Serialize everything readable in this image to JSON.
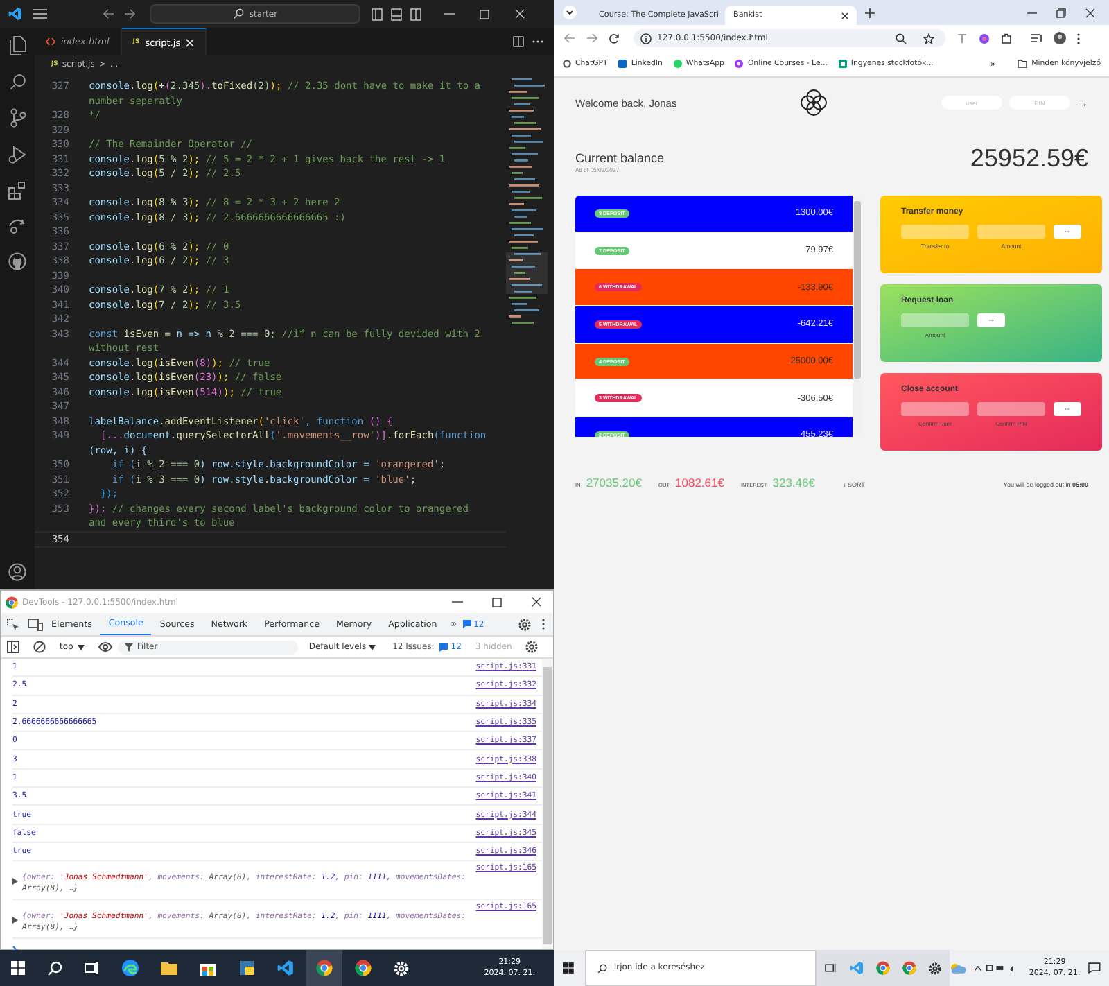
{
  "vscode": {
    "search": "starter",
    "tabs": [
      {
        "label": "index.html",
        "kind": "html",
        "selected": false
      },
      {
        "label": "script.js",
        "kind": "js",
        "icon_text": "JS",
        "selected": true
      }
    ],
    "breadcrumb": {
      "icon_text": "JS",
      "file": "script.js",
      "separator": ">",
      "rest": "..."
    },
    "lines": [
      {
        "n": "327",
        "tokens": [
          {
            "text": "console",
            "kind": "var"
          },
          {
            "text": ".",
            "kind": "plain"
          },
          {
            "text": "log",
            "kind": "fn"
          },
          {
            "text": "(",
            "kind": "gold"
          },
          {
            "text": "+",
            "kind": "plain"
          },
          {
            "text": "(",
            "kind": "pink"
          },
          {
            "text": "2.345",
            "kind": "num"
          },
          {
            "text": ").",
            "kind": "pink"
          },
          {
            "text": "toFixed",
            "kind": "fn"
          },
          {
            "text": "(2)",
            "kind": "num"
          },
          {
            "text": ");",
            "kind": "gold"
          },
          {
            "text": " // 2.35 dont have to make it to a number seperatly",
            "kind": "comment"
          }
        ]
      },
      {
        "n": "328",
        "tokens": [
          {
            "text": "*/",
            "kind": "comment"
          }
        ]
      },
      {
        "n": "329"
      },
      {
        "n": "330",
        "tokens": [
          {
            "text": "// The Remainder Operator //",
            "kind": "comment"
          }
        ]
      },
      {
        "n": "331",
        "tokens": [
          {
            "text": "console",
            "kind": "var"
          },
          {
            "text": ".",
            "kind": "plain"
          },
          {
            "text": "log",
            "kind": "fn"
          },
          {
            "text": "(",
            "kind": "gold"
          },
          {
            "text": "5 % 2",
            "kind": "num"
          },
          {
            "text": ");",
            "kind": "gold"
          },
          {
            "text": " // 5 = 2 * 2 + 1 gives back the rest -> 1",
            "kind": "comment"
          }
        ]
      },
      {
        "n": "332",
        "tokens": [
          {
            "text": "console",
            "kind": "var"
          },
          {
            "text": ".",
            "kind": "plain"
          },
          {
            "text": "log",
            "kind": "fn"
          },
          {
            "text": "(",
            "kind": "gold"
          },
          {
            "text": "5 / 2",
            "kind": "num"
          },
          {
            "text": ");",
            "kind": "gold"
          },
          {
            "text": " // 2.5",
            "kind": "comment"
          }
        ]
      },
      {
        "n": "333"
      },
      {
        "n": "334",
        "tokens": [
          {
            "text": "console",
            "kind": "var"
          },
          {
            "text": ".",
            "kind": "plain"
          },
          {
            "text": "log",
            "kind": "fn"
          },
          {
            "text": "(",
            "kind": "gold"
          },
          {
            "text": "8 % 3",
            "kind": "num"
          },
          {
            "text": ");",
            "kind": "gold"
          },
          {
            "text": " // 8 = 2 * 3 + 2 here 2",
            "kind": "comment"
          }
        ]
      },
      {
        "n": "335",
        "tokens": [
          {
            "text": "console",
            "kind": "var"
          },
          {
            "text": ".",
            "kind": "plain"
          },
          {
            "text": "log",
            "kind": "fn"
          },
          {
            "text": "(",
            "kind": "gold"
          },
          {
            "text": "8 / 3",
            "kind": "num"
          },
          {
            "text": ");",
            "kind": "gold"
          },
          {
            "text": " // 2.6666666666666665 :)",
            "kind": "comment"
          }
        ]
      },
      {
        "n": "336"
      },
      {
        "n": "337",
        "tokens": [
          {
            "text": "console",
            "kind": "var"
          },
          {
            "text": ".",
            "kind": "plain"
          },
          {
            "text": "log",
            "kind": "fn"
          },
          {
            "text": "(",
            "kind": "gold"
          },
          {
            "text": "6 % 2",
            "kind": "num"
          },
          {
            "text": ");",
            "kind": "gold"
          },
          {
            "text": " // 0",
            "kind": "comment"
          }
        ]
      },
      {
        "n": "338",
        "tokens": [
          {
            "text": "console",
            "kind": "var"
          },
          {
            "text": ".",
            "kind": "plain"
          },
          {
            "text": "log",
            "kind": "fn"
          },
          {
            "text": "(",
            "kind": "gold"
          },
          {
            "text": "6 / 2",
            "kind": "num"
          },
          {
            "text": ");",
            "kind": "gold"
          },
          {
            "text": " // 3",
            "kind": "comment"
          }
        ]
      },
      {
        "n": "339"
      },
      {
        "n": "340",
        "tokens": [
          {
            "text": "console",
            "kind": "var"
          },
          {
            "text": ".",
            "kind": "plain"
          },
          {
            "text": "log",
            "kind": "fn"
          },
          {
            "text": "(",
            "kind": "gold"
          },
          {
            "text": "7 % 2",
            "kind": "num"
          },
          {
            "text": ");",
            "kind": "gold"
          },
          {
            "text": " // 1",
            "kind": "comment"
          }
        ]
      },
      {
        "n": "341",
        "tokens": [
          {
            "text": "console",
            "kind": "var"
          },
          {
            "text": ".",
            "kind": "plain"
          },
          {
            "text": "log",
            "kind": "fn"
          },
          {
            "text": "(",
            "kind": "gold"
          },
          {
            "text": "7 / 2",
            "kind": "num"
          },
          {
            "text": ");",
            "kind": "gold"
          },
          {
            "text": " // 3.5",
            "kind": "comment"
          }
        ]
      },
      {
        "n": "342"
      },
      {
        "n": "343",
        "tokens": [
          {
            "text": "const ",
            "kind": "keyword"
          },
          {
            "text": "isEven = ",
            "kind": "fn"
          },
          {
            "text": "n => n",
            "kind": "var"
          },
          {
            "text": " % 2 === 0;",
            "kind": "num"
          },
          {
            "text": " //if n can be fully devided with 2 without rest",
            "kind": "comment"
          }
        ]
      },
      {
        "n": "344",
        "tokens": [
          {
            "text": "console",
            "kind": "var"
          },
          {
            "text": ".",
            "kind": "plain"
          },
          {
            "text": "log",
            "kind": "fn"
          },
          {
            "text": "(",
            "kind": "gold"
          },
          {
            "text": "isEven",
            "kind": "fn"
          },
          {
            "text": "(8)",
            "kind": "pink"
          },
          {
            "text": ");",
            "kind": "gold"
          },
          {
            "text": " // true",
            "kind": "comment"
          }
        ]
      },
      {
        "n": "345",
        "tokens": [
          {
            "text": "console",
            "kind": "var"
          },
          {
            "text": ".",
            "kind": "plain"
          },
          {
            "text": "log",
            "kind": "fn"
          },
          {
            "text": "(",
            "kind": "gold"
          },
          {
            "text": "isEven",
            "kind": "fn"
          },
          {
            "text": "(23)",
            "kind": "pink"
          },
          {
            "text": ");",
            "kind": "gold"
          },
          {
            "text": " // false",
            "kind": "comment"
          }
        ]
      },
      {
        "n": "346",
        "tokens": [
          {
            "text": "console",
            "kind": "var"
          },
          {
            "text": ".",
            "kind": "plain"
          },
          {
            "text": "log",
            "kind": "fn"
          },
          {
            "text": "(",
            "kind": "gold"
          },
          {
            "text": "isEven",
            "kind": "fn"
          },
          {
            "text": "(514)",
            "kind": "pink"
          },
          {
            "text": ");",
            "kind": "gold"
          },
          {
            "text": " // true",
            "kind": "comment"
          }
        ]
      },
      {
        "n": "347"
      },
      {
        "n": "348",
        "tokens": [
          {
            "text": "labelBalance.",
            "kind": "var"
          },
          {
            "text": "addEventListener",
            "kind": "fn"
          },
          {
            "text": "(",
            "kind": "gold"
          },
          {
            "text": "'click'",
            "kind": "string"
          },
          {
            "text": ", function",
            "kind": "keyword"
          },
          {
            "text": " () {",
            "kind": "pink"
          }
        ]
      },
      {
        "n": "349",
        "tokens": [
          {
            "text": "  [...",
            "kind": "pink"
          },
          {
            "text": "document.",
            "kind": "var"
          },
          {
            "text": "querySelectorAll",
            "kind": "fn"
          },
          {
            "text": "(",
            "kind": "blue"
          },
          {
            "text": "'.movements__row'",
            "kind": "string"
          },
          {
            "text": ")]",
            "kind": "pink"
          },
          {
            "text": ".forEach",
            "kind": "fn"
          },
          {
            "text": "(function",
            "kind": "keyword"
          },
          {
            "text": " (row, i) {",
            "kind": "var"
          }
        ]
      },
      {
        "n": "350",
        "tokens": [
          {
            "text": "    if (",
            "kind": "keyword"
          },
          {
            "text": "i % 2 === 0",
            "kind": "num"
          },
          {
            "text": ") row.style.backgroundColor = ",
            "kind": "var"
          },
          {
            "text": "'orangered'",
            "kind": "string"
          },
          {
            "text": ";",
            "kind": "plain"
          }
        ]
      },
      {
        "n": "351",
        "tokens": [
          {
            "text": "    if (",
            "kind": "keyword"
          },
          {
            "text": "i % 3 === 0",
            "kind": "num"
          },
          {
            "text": ") row.style.backgroundColor = ",
            "kind": "var"
          },
          {
            "text": "'blue'",
            "kind": "string"
          },
          {
            "text": ";",
            "kind": "plain"
          }
        ]
      },
      {
        "n": "352",
        "tokens": [
          {
            "text": "  });",
            "kind": "blue"
          }
        ]
      },
      {
        "n": "353",
        "tokens": [
          {
            "text": "});",
            "kind": "pink"
          },
          {
            "text": " // changes every second label's background color to orangered and every third's to blue",
            "kind": "comment"
          }
        ]
      },
      {
        "n": "354",
        "current": true
      }
    ]
  },
  "devtools": {
    "title": "DevTools - 127.0.0.1:5500/index.html",
    "tabs": [
      {
        "label": "Elements",
        "selected": false
      },
      {
        "label": "Console",
        "selected": true
      },
      {
        "label": "Sources",
        "selected": false
      },
      {
        "label": "Network",
        "selected": false
      },
      {
        "label": "Performance",
        "selected": false
      },
      {
        "label": "Memory",
        "selected": false
      },
      {
        "label": "Application",
        "selected": false
      }
    ],
    "more": "»",
    "issues_badge": "12",
    "context": "top",
    "filter_placeholder": "Filter",
    "levels": "Default levels",
    "issues_label": "12 Issues:",
    "issues_count": "12",
    "hidden": "3 hidden",
    "messages": [
      {
        "kind": "value",
        "text": "1",
        "source": "script.js:331"
      },
      {
        "kind": "value",
        "text": "2.5",
        "source": "script.js:332"
      },
      {
        "kind": "value",
        "text": "2",
        "source": "script.js:334"
      },
      {
        "kind": "value",
        "text": "2.6666666666666665",
        "source": "script.js:335"
      },
      {
        "kind": "value",
        "text": "0",
        "source": "script.js:337"
      },
      {
        "kind": "value",
        "text": "3",
        "source": "script.js:338"
      },
      {
        "kind": "value",
        "text": "1",
        "source": "script.js:340"
      },
      {
        "kind": "value",
        "text": "3.5",
        "source": "script.js:341"
      },
      {
        "kind": "value",
        "text": "true",
        "source": "script.js:344"
      },
      {
        "kind": "value",
        "text": "false",
        "source": "script.js:345"
      },
      {
        "kind": "value",
        "text": "true",
        "source": "script.js:346"
      },
      {
        "kind": "object",
        "source": "script.js:165",
        "expanded": false,
        "tokens": [
          {
            "text": "{owner: ",
            "kind": "key"
          },
          {
            "text": "'Jonas Schmedtmann'",
            "kind": "string"
          },
          {
            "text": ", movements: ",
            "kind": "key"
          },
          {
            "text": "Array(8)",
            "kind": "value"
          },
          {
            "text": ", interestRate: ",
            "kind": "key"
          },
          {
            "text": "1.2",
            "kind": "num"
          },
          {
            "text": ", pin: ",
            "kind": "key"
          },
          {
            "text": "1111",
            "kind": "num"
          },
          {
            "text": ", movementsDates: ",
            "kind": "key"
          },
          {
            "text": "Array(8), …}",
            "kind": "value"
          }
        ]
      },
      {
        "kind": "object",
        "source": "script.js:165",
        "expanded": false,
        "tokens": [
          {
            "text": "{owner: ",
            "kind": "key"
          },
          {
            "text": "'Jonas Schmedtmann'",
            "kind": "string"
          },
          {
            "text": ", movements: ",
            "kind": "key"
          },
          {
            "text": "Array(8)",
            "kind": "value"
          },
          {
            "text": ", interestRate: ",
            "kind": "key"
          },
          {
            "text": "1.2",
            "kind": "num"
          },
          {
            "text": ", pin: ",
            "kind": "key"
          },
          {
            "text": "1111",
            "kind": "num"
          },
          {
            "text": ", movementsDates: ",
            "kind": "key"
          },
          {
            "text": "Array(8), …}",
            "kind": "value"
          }
        ]
      }
    ]
  },
  "browser": {
    "tabs": [
      {
        "title": "Course: The Complete JavaScri",
        "selected": false
      },
      {
        "title": "Bankist",
        "selected": true
      }
    ],
    "url": "127.0.0.1:5500/index.html",
    "bookmarks": [
      {
        "label": "ChatGPT",
        "kind": "gpt"
      },
      {
        "label": "LinkedIn",
        "kind": "in"
      },
      {
        "label": "WhatsApp",
        "kind": "wa"
      },
      {
        "label": "Online Courses - Le...",
        "kind": "course"
      },
      {
        "label": "Ingyenes stockfotók...",
        "kind": "photo"
      }
    ],
    "more": "»",
    "all_bookmarks": "Minden könyvjelző"
  },
  "bank": {
    "welcome": "Welcome back, Jonas",
    "user_placeholder": "user",
    "pin_placeholder": "PIN",
    "login": "→",
    "balance_label": "Current balance",
    "date": "As of 05/03/2037",
    "balance": "25952.59€",
    "movements": [
      {
        "type": "8 DEPOSIT",
        "kind": "deposit",
        "value": "1300.00€",
        "color": "#0000ff"
      },
      {
        "type": "7 DEPOSIT",
        "kind": "deposit",
        "value": "79.97€",
        "color": "#ffffff"
      },
      {
        "type": "6 WITHDRAWAL",
        "kind": "withdrawal",
        "value": "-133.90€",
        "color": "#ff4500"
      },
      {
        "type": "5 WITHDRAWAL",
        "kind": "withdrawal",
        "value": "-642.21€",
        "color": "#0000ff"
      },
      {
        "type": "4 DEPOSIT",
        "kind": "deposit",
        "value": "25000.00€",
        "color": "#ff4500"
      },
      {
        "type": "3 WITHDRAWAL",
        "kind": "withdrawal",
        "value": "-306.50€",
        "color": "#ffffff"
      },
      {
        "type": "2 DEPOSIT",
        "kind": "deposit",
        "value": "455.23€",
        "color": "#0000ff"
      }
    ],
    "summary": [
      {
        "label": "IN",
        "value": "27035.20€",
        "kind": "in"
      },
      {
        "label": "OUT",
        "value": "1082.61€",
        "kind": "out"
      },
      {
        "label": "INTEREST",
        "value": "323.46€",
        "kind": "in"
      }
    ],
    "sort": "↓ SORT",
    "logout": "You will be logged out in **05:00**",
    "operations": [
      {
        "kind": "transfer",
        "title": "Transfer money",
        "fields": [
          "Transfer to",
          "Amount"
        ],
        "button": "→"
      },
      {
        "kind": "loan",
        "title": "Request loan",
        "fields": [
          "Amount"
        ],
        "button": "→"
      },
      {
        "kind": "close",
        "title": "Close account",
        "fields": [
          "Confirm user",
          "Confirm PIN"
        ],
        "button": "→"
      }
    ]
  },
  "taskbar": {
    "left": {
      "time": "21:29",
      "date": "2024. 07. 21."
    },
    "right": {
      "search_placeholder": "Írjon ide a kereséshez",
      "time": "21:29",
      "date": "2024. 07. 21."
    }
  }
}
